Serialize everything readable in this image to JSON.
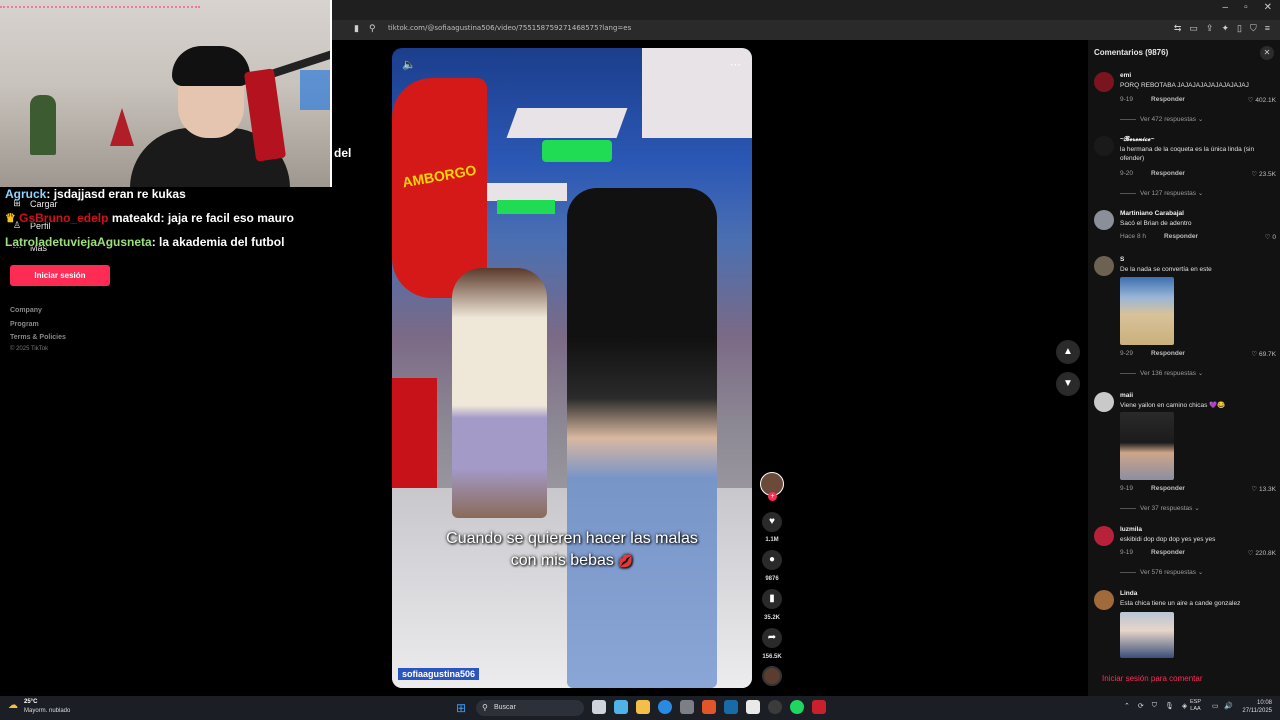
{
  "browser": {
    "url": "tiktok.com/@sofiaagustina506/video/755158759271468575?lang=es"
  },
  "sidebar": {
    "items": [
      {
        "label": "Cargar",
        "icon": "upload-icon"
      },
      {
        "label": "Perfil",
        "icon": "profile-icon"
      },
      {
        "label": "Más",
        "icon": "more-icon"
      }
    ],
    "login_label": "Iniciar sesión",
    "footer_links": [
      "Company",
      "Program",
      "Terms & Policies"
    ],
    "copyright": "© 2025 TikTok"
  },
  "stream": {
    "overlay_word": "del",
    "chat": [
      {
        "user": "Agruck",
        "user_color": "#8fd3ff",
        "message": "jsdajjasd eran re kukas"
      },
      {
        "user": "GsBruno_edelp",
        "user_color": "#d0111b",
        "message": "mateakd: jaja re facil eso mauro"
      },
      {
        "user": "LatroladetuviejaAgusneta",
        "user_color": "#9be07a",
        "message": "la akademia del futbol"
      }
    ]
  },
  "video": {
    "caption_line1": "Cuando se quieren hacer las malas",
    "caption_line2": "con mis bebas",
    "caption_emoji": "💋",
    "author": "sofiaagustina506",
    "sign_text": "AMBORGO"
  },
  "actions": {
    "likes": "1.1M",
    "comments": "9876",
    "saves": "35.2K",
    "shares": "156.5K"
  },
  "comments_panel": {
    "title": "Comentarios (9876)",
    "login_prompt": "Iniciar sesión para comentar",
    "items": [
      {
        "name": "emi",
        "text": "PORQ REBOTABA JAJAJAJAJAJAJAJAJAJ",
        "date": "9-19",
        "reply": "Responder",
        "likes": "402.1K",
        "more": "Ver 472 respuestas",
        "avatar_color": "#7a1520"
      },
      {
        "name": "~𝓑𝓮𝓻𝓮𝓷𝓲𝓬𝓮~",
        "text": "la hermana de la coqueta es la única linda (sin ofender)",
        "date": "9-20",
        "reply": "Responder",
        "likes": "23.5K",
        "more": "Ver 127 respuestas",
        "avatar_color": "#1a1a1a"
      },
      {
        "name": "Martiniano Carabajal",
        "text": "Sacó el Brian de adentro",
        "date": "Hace 8 h",
        "reply": "Responder",
        "likes": "0",
        "more": "",
        "avatar_color": "#8a8f9a"
      },
      {
        "name": "S",
        "text": "De la nada se convertía en este",
        "date": "9-29",
        "reply": "Responder",
        "likes": "69.7K",
        "more": "Ver 136 respuestas",
        "avatar_color": "#6d6252"
      },
      {
        "name": "maii",
        "text": "Viene yailon en camino chicas 💜😂",
        "date": "9-19",
        "reply": "Responder",
        "likes": "13.3K",
        "more": "Ver 37 respuestas",
        "avatar_color": "#c9c9c9"
      },
      {
        "name": "luzmila",
        "text": "eskibidi dop dop dop yes yes yes",
        "date": "9-19",
        "reply": "Responder",
        "likes": "220.8K",
        "more": "Ver 576 respuestas",
        "avatar_color": "#b8213a"
      },
      {
        "name": "Linda",
        "text": "Esta chica tiene un aire a cande gonzalez",
        "date": "",
        "reply": "",
        "likes": "",
        "more": "",
        "avatar_color": "#a06a3a"
      }
    ]
  },
  "taskbar": {
    "temp": "25°C",
    "weather": "Mayorm. nublado",
    "search": "Buscar",
    "lang1": "ESP",
    "lang2": "LAA",
    "time": "10:08",
    "date": "27/11/2025"
  }
}
